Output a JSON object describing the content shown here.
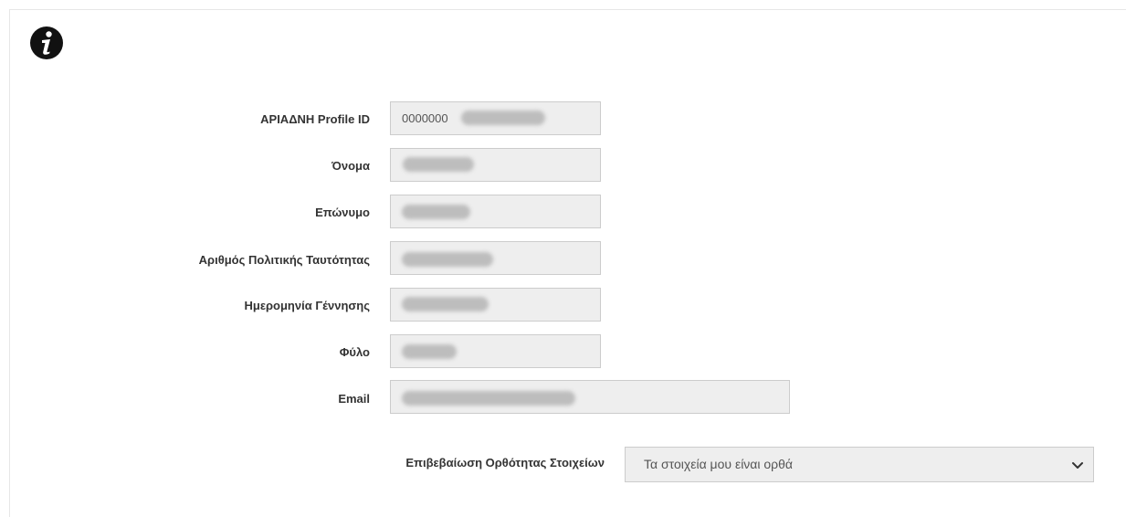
{
  "icons": {
    "info": "info-icon",
    "dropdown": "chevron-down-icon"
  },
  "form": {
    "fields": [
      {
        "label": "ΑΡΙΑΔΝΗ Profile ID",
        "value": "0000000"
      },
      {
        "label": "Όνομα",
        "value": ""
      },
      {
        "label": "Επώνυμο",
        "value": ""
      },
      {
        "label": "Αριθμός Πολιτικής Ταυτότητας",
        "value": ""
      },
      {
        "label": "Ημερομηνία Γέννησης",
        "value": ""
      },
      {
        "label": "Φύλο",
        "value": ""
      },
      {
        "label": "Email",
        "value": ""
      }
    ],
    "confirmation": {
      "label": "Επιβεβαίωση Ορθότητας Στοιχείων",
      "selected": "Τα στοιχεία μου είναι ορθά"
    }
  }
}
